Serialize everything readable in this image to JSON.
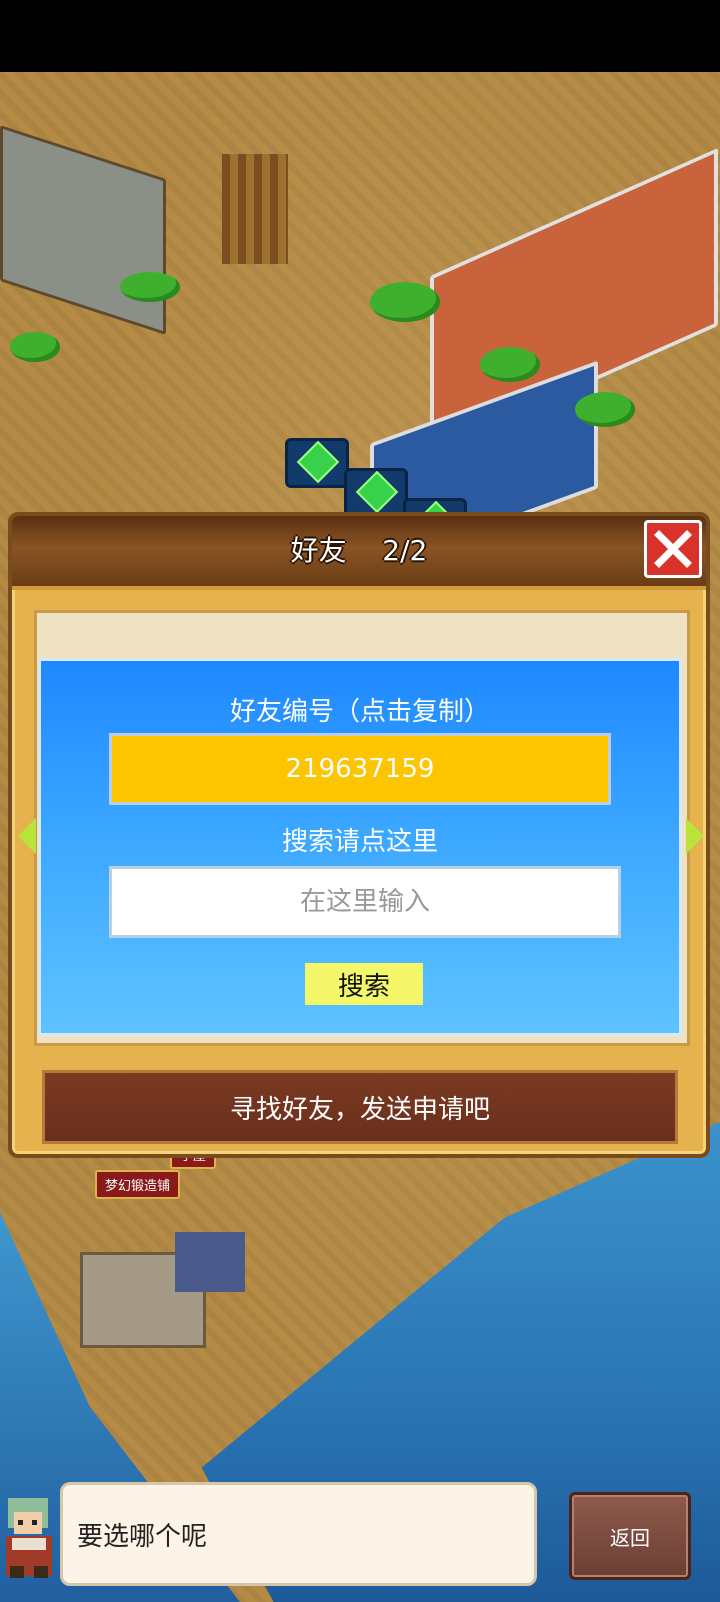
{
  "dialog": {
    "title": "好友",
    "count": "2/2",
    "close_icon": "close-icon"
  },
  "friend_panel": {
    "id_label": "好友编号（点击复制）",
    "friend_id": "219637159",
    "search_label": "搜索请点这里",
    "search_placeholder": "在这里输入",
    "search_value": "",
    "search_button": "搜索"
  },
  "find_friends_button": "寻找好友，发送申请吧",
  "world_labels": {
    "cabin": "小屋",
    "forge": "梦幻锻造铺"
  },
  "bottom": {
    "speech": "要选哪个呢",
    "back_button": "返回"
  },
  "colors": {
    "panel_blue": "#1e88ff",
    "id_field_yellow": "#fdc400",
    "search_button_yellow": "#f5f76a",
    "close_red": "#d9322a",
    "header_brown": "#6b3d15"
  }
}
